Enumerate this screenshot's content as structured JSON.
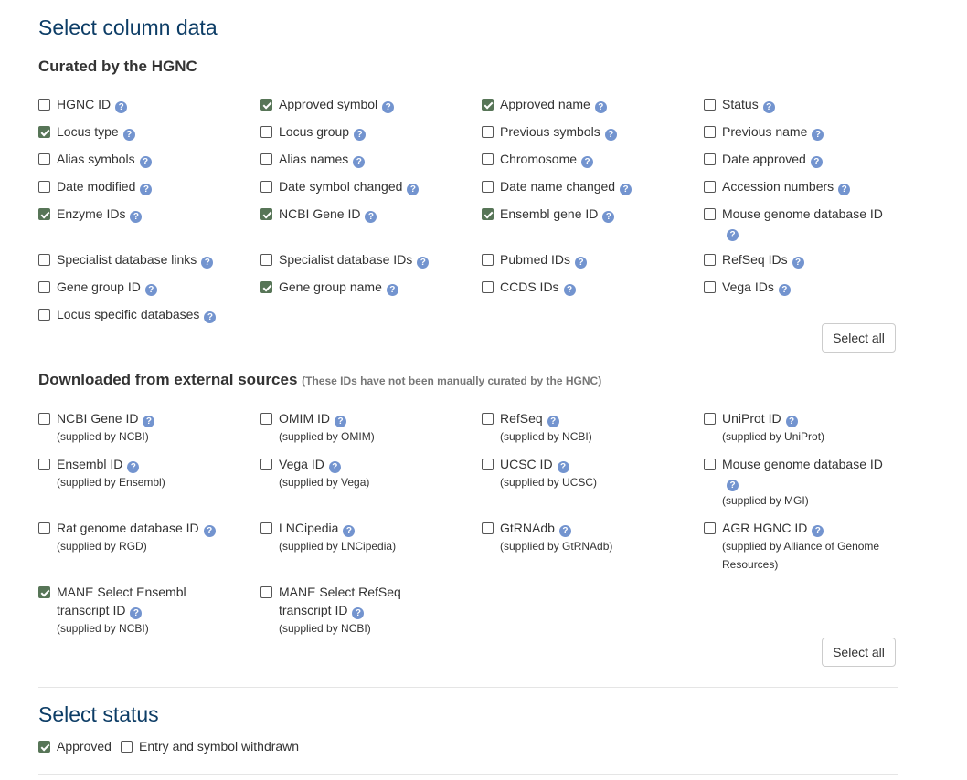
{
  "select_column_title": "Select column data",
  "curated": {
    "heading": "Curated by the HGNC",
    "items": [
      {
        "label": "HGNC ID",
        "checked": false
      },
      {
        "label": "Approved symbol",
        "checked": true
      },
      {
        "label": "Approved name",
        "checked": true
      },
      {
        "label": "Status",
        "checked": false
      },
      {
        "label": "Locus type",
        "checked": true
      },
      {
        "label": "Locus group",
        "checked": false
      },
      {
        "label": "Previous symbols",
        "checked": false
      },
      {
        "label": "Previous name",
        "checked": false
      },
      {
        "label": "Alias symbols",
        "checked": false
      },
      {
        "label": "Alias names",
        "checked": false
      },
      {
        "label": "Chromosome",
        "checked": false
      },
      {
        "label": "Date approved",
        "checked": false
      },
      {
        "label": "Date modified",
        "checked": false
      },
      {
        "label": "Date symbol changed",
        "checked": false
      },
      {
        "label": "Date name changed",
        "checked": false
      },
      {
        "label": "Accession numbers",
        "checked": false
      },
      {
        "label": "Enzyme IDs",
        "checked": true
      },
      {
        "label": "NCBI Gene ID",
        "checked": true
      },
      {
        "label": "Ensembl gene ID",
        "checked": true
      },
      {
        "label": "Mouse genome database ID",
        "checked": false
      },
      {
        "label": "Specialist database links",
        "checked": false
      },
      {
        "label": "Specialist database IDs",
        "checked": false
      },
      {
        "label": "Pubmed IDs",
        "checked": false
      },
      {
        "label": "RefSeq IDs",
        "checked": false
      },
      {
        "label": "Gene group ID",
        "checked": false
      },
      {
        "label": "Gene group name",
        "checked": true
      },
      {
        "label": "CCDS IDs",
        "checked": false
      },
      {
        "label": "Vega IDs",
        "checked": false
      },
      {
        "label": "Locus specific databases",
        "checked": false
      }
    ],
    "select_all": "Select all"
  },
  "external": {
    "heading": "Downloaded from external sources",
    "note": "(These IDs have not been manually curated by the HGNC)",
    "items": [
      {
        "label": "NCBI Gene ID",
        "supplied": "(supplied by NCBI)",
        "checked": false
      },
      {
        "label": "OMIM ID",
        "supplied": "(supplied by OMIM)",
        "checked": false
      },
      {
        "label": "RefSeq",
        "supplied": "(supplied by NCBI)",
        "checked": false
      },
      {
        "label": "UniProt ID",
        "supplied": "(supplied by UniProt)",
        "checked": false
      },
      {
        "label": "Ensembl ID",
        "supplied": "(supplied by Ensembl)",
        "checked": false
      },
      {
        "label": "Vega ID",
        "supplied": "(supplied by Vega)",
        "checked": false
      },
      {
        "label": "UCSC ID",
        "supplied": "(supplied by UCSC)",
        "checked": false
      },
      {
        "label": "Mouse genome database ID",
        "supplied": "(supplied by MGI)",
        "checked": false
      },
      {
        "label": "Rat genome database ID",
        "supplied": "(supplied by RGD)",
        "checked": false
      },
      {
        "label": "LNCipedia",
        "supplied": "(supplied by LNCipedia)",
        "checked": false
      },
      {
        "label": "GtRNAdb",
        "supplied": "(supplied by GtRNAdb)",
        "checked": false
      },
      {
        "label": "AGR HGNC ID",
        "supplied": "(supplied by Alliance of Genome Resources)",
        "checked": false
      },
      {
        "label": "MANE Select Ensembl transcript ID",
        "supplied": "(supplied by NCBI)",
        "checked": true
      },
      {
        "label": "MANE Select RefSeq transcript ID",
        "supplied": "(supplied by NCBI)",
        "checked": false
      }
    ],
    "select_all": "Select all"
  },
  "status": {
    "title": "Select status",
    "items": [
      {
        "label": "Approved",
        "checked": true
      },
      {
        "label": "Entry and symbol withdrawn",
        "checked": false
      }
    ]
  },
  "help_glyph": "?",
  "icons": {
    "help": "question-circle-icon",
    "checked": "checkbox-checked",
    "unchecked": "checkbox-unchecked"
  },
  "colors": {
    "heading": "#0d3d66",
    "checkbox_checked": "#577557",
    "help_icon": "#7394cf"
  }
}
